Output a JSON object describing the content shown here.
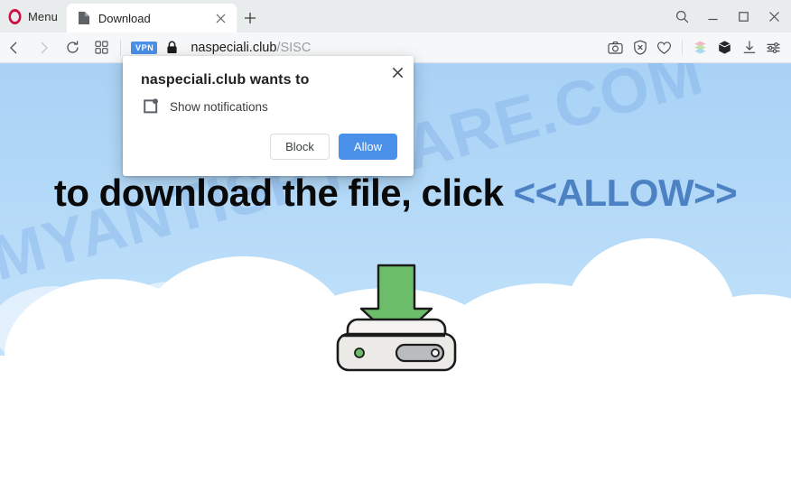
{
  "browser": {
    "menu_label": "Menu",
    "logo_icon": "opera-logo",
    "tabs": [
      {
        "title": "Download",
        "favicon": "page-file-icon",
        "close_icon": "close-icon"
      }
    ],
    "new_tab_icon": "plus-icon",
    "window_controls": [
      {
        "name": "search-icon",
        "glyph": "search"
      },
      {
        "name": "minimize-icon",
        "glyph": "minimize"
      },
      {
        "name": "maximize-icon",
        "glyph": "maximize"
      },
      {
        "name": "close-window-icon",
        "glyph": "close"
      }
    ],
    "nav": {
      "back_icon": "back-arrow-icon",
      "forward_icon": "forward-arrow-icon",
      "reload_icon": "reload-icon",
      "speeddial_icon": "grid-icon",
      "vpn_badge": "VPN",
      "lock_icon": "padlock-icon",
      "url_host": "naspeciali.club",
      "url_path": "/SISC"
    },
    "toolbar_icons": [
      {
        "name": "snapshot-camera-icon"
      },
      {
        "name": "ad-blocker-shield-icon"
      },
      {
        "name": "heart-favorite-icon"
      },
      {
        "name": "extension-color-stack-icon"
      },
      {
        "name": "extension-cube-icon"
      },
      {
        "name": "downloads-icon"
      },
      {
        "name": "easy-setup-sliders-icon"
      }
    ]
  },
  "dialog": {
    "title": "naspeciali.club wants to",
    "permission_icon": "notification-bell-icon",
    "permission_text": "Show notifications",
    "close_icon": "close-icon",
    "block_label": "Block",
    "allow_label": "Allow",
    "allow_color": "#4a90e8"
  },
  "page": {
    "headline_lead": "to download the file, click",
    "headline_allow": "<<ALLOW>>",
    "headline_allow_color": "#4c81c4",
    "watermark": "MYANTISPYWARE.COM",
    "illustration": "hard-drive-download-icon",
    "sky_color": "#b5daf8",
    "cloud_color": "#ffffff",
    "arrow_color": "#6cbd6a"
  }
}
